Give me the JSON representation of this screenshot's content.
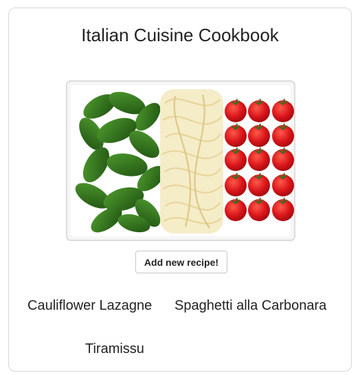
{
  "page": {
    "title": "Italian Cuisine Cookbook"
  },
  "hero_image": {
    "icon": "italian-flag-pasta-plate-image",
    "colors": {
      "basil": "#2f6b1f",
      "pasta": "#f3e6b5",
      "tomato": "#d8141a",
      "plate": "#ffffff"
    }
  },
  "actions": {
    "add_label": "Add new recipe!"
  },
  "recipes": [
    {
      "name": "Cauliflower Lazagne"
    },
    {
      "name": "Spaghetti alla Carbonara"
    },
    {
      "name": "Tiramissu"
    }
  ]
}
